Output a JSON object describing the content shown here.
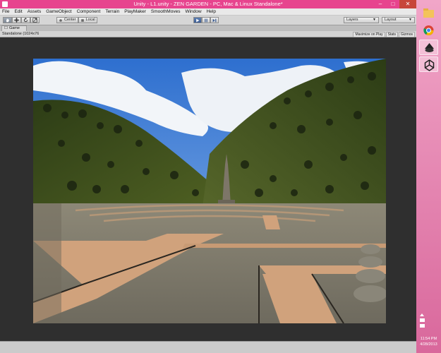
{
  "window": {
    "title": "Unity - L1.unity - ZEN GARDEN - PC, Mac & Linux Standalone*",
    "minimize": "–",
    "maximize": "□",
    "close": "✕"
  },
  "menu": [
    "File",
    "Edit",
    "Assets",
    "GameObject",
    "Component",
    "Terrain",
    "PlayMaker",
    "SmoothMoves",
    "Window",
    "Help"
  ],
  "toolbar": {
    "pivot": "Center",
    "space": "Local",
    "layers": "Layers",
    "layout": "Layout"
  },
  "game_tab": {
    "label": "Game",
    "resolution": "Standalone (1024x76",
    "maximize_on_play": "Maximize on Play",
    "stats": "Stats",
    "gizmos": "Gizmos"
  },
  "taskbar": {
    "time": "11:54 PM",
    "date": "4/28/2013"
  },
  "colors": {
    "titlebar": "#e7448e",
    "taskbar": "#e07aa8",
    "play_active": "#4a6ea6"
  },
  "icons": {
    "hand_tool": "hand-icon",
    "move_tool": "move-icon",
    "rotate_tool": "rotate-icon",
    "scale_tool": "scale-icon",
    "play": "play-icon",
    "pause": "pause-icon",
    "step": "step-icon"
  }
}
